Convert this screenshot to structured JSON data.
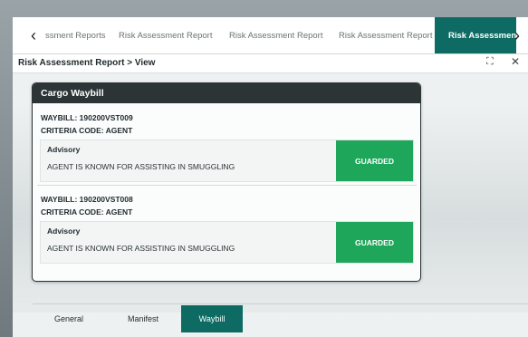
{
  "tabs": [
    {
      "label": "ssment Reports",
      "active": false
    },
    {
      "label": "Risk Assessment Report",
      "active": false
    },
    {
      "label": "Risk Assessment Report",
      "active": false
    },
    {
      "label": "Risk Assessment Report",
      "active": false
    },
    {
      "label": "Risk Assessment",
      "active": true
    }
  ],
  "nav_icons": {
    "left": "chevron-left-icon",
    "right": "chevron-right-icon"
  },
  "header": {
    "breadcrumb": "Risk Assessment Report > View",
    "expand_icon": "⛶",
    "close_icon": "✕"
  },
  "card": {
    "title": "Cargo Waybill",
    "entries": [
      {
        "waybill": "WAYBILL: 190200VST009",
        "criteria": "CRITERIA CODE: AGENT",
        "advisory_title": "Advisory",
        "advisory_text": "AGENT IS KNOWN FOR ASSISTING IN SMUGGLING",
        "level": "GUARDED"
      },
      {
        "waybill": "WAYBILL: 190200VST008",
        "criteria": "CRITERIA CODE: AGENT",
        "advisory_title": "Advisory",
        "advisory_text": "AGENT IS KNOWN FOR ASSISTING IN SMUGGLING",
        "level": "GUARDED"
      }
    ]
  },
  "bottom_tabs": [
    {
      "label": "General",
      "active": false
    },
    {
      "label": "Manifest",
      "active": false
    },
    {
      "label": "Waybill",
      "active": true
    }
  ],
  "colors": {
    "accent": "#0d6b63",
    "guarded": "#1ea65a",
    "card_header": "#2c3436"
  }
}
